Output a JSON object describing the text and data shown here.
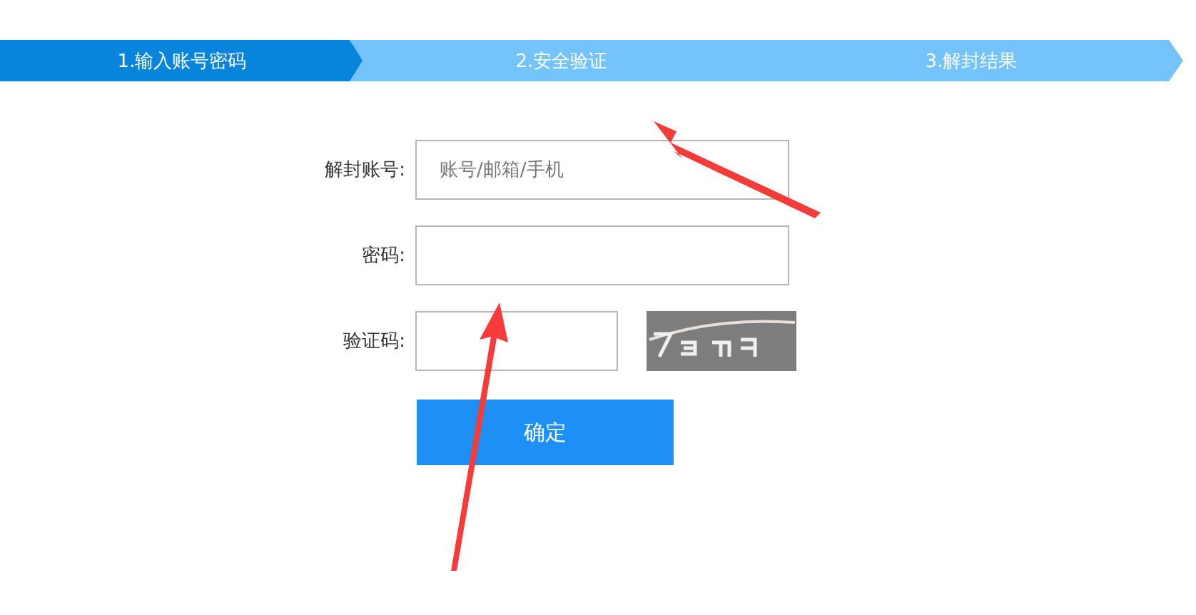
{
  "steps": [
    {
      "label": "1.输入账号密码",
      "selected": true
    },
    {
      "label": "2.安全验证",
      "selected": false
    },
    {
      "label": "3.解封结果",
      "selected": false
    }
  ],
  "form": {
    "fields": [
      {
        "label": "解封账号:",
        "kind": "text",
        "placeholder": "账号/邮箱/手机"
      },
      {
        "label": "密码:",
        "kind": "password"
      },
      {
        "label": "验证码:",
        "kind": "captcha"
      }
    ],
    "submit": "确定"
  }
}
